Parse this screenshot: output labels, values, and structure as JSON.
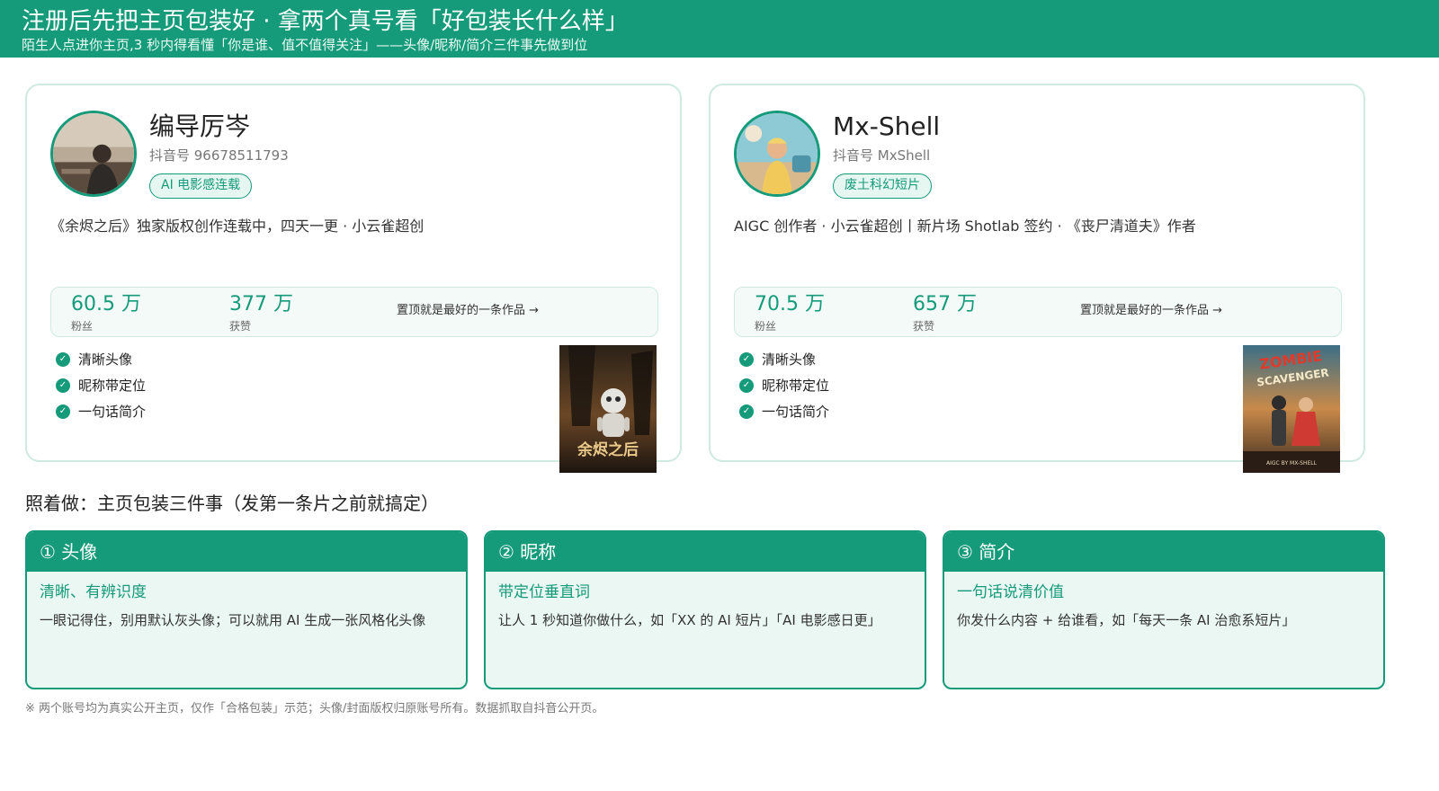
{
  "banner": {
    "title": "注册后先把主页包装好 ·  拿两个真号看「好包装长什么样」",
    "subtitle": "陌生人点进你主页,3 秒内得看懂「你是谁、值不值得关注」——头像/昵称/简介三件事先做到位"
  },
  "profiles": [
    {
      "name": "编导厉岑",
      "account": "抖音号 96678511793",
      "tag": "AI 电影感连载",
      "bio": "《余烬之后》独家版权创作连载中，四天一更 ·  小云雀超创",
      "followers_value": "60.5 万",
      "followers_label": "粉丝",
      "likes_value": "377 万",
      "likes_label": "获赞",
      "pinned": "置顶就是最好的一条作品 →",
      "checks": [
        "清晰头像",
        "昵称带定位",
        "一句话简介"
      ],
      "poster_title": "余烬之后"
    },
    {
      "name": "Mx-Shell",
      "account": "抖音号 MxShell",
      "tag": "废土科幻短片",
      "bio": "AIGC 创作者 ·  小云雀超创丨新片场 Shotlab 签约 ·  《丧尸清道夫》作者",
      "followers_value": "70.5 万",
      "followers_label": "粉丝",
      "likes_value": "657 万",
      "likes_label": "获赞",
      "pinned": "置顶就是最好的一条作品 →",
      "checks": [
        "清晰头像",
        "昵称带定位",
        "一句话简介"
      ],
      "poster_title": "ZOMBIE SCAVENGER"
    }
  ],
  "section_title": "照着做：主页包装三件事（发第一条片之前就搞定）",
  "steps": [
    {
      "head": "① 头像",
      "sub": "清晰、有辨识度",
      "body": "一眼记得住，别用默认灰头像；可以就用 AI 生成一张风格化头像"
    },
    {
      "head": "② 昵称",
      "sub": "带定位垂直词",
      "body": "让人 1 秒知道你做什么，如「XX 的 AI 短片」「AI 电影感日更」"
    },
    {
      "head": "③ 简介",
      "sub": "一句话说清价值",
      "body": "你发什么内容 + 给谁看，如「每天一条 AI 治愈系短片」"
    }
  ],
  "footnote": "※ 两个账号均为真实公开主页，仅作「合格包装」示范；头像/封面版权归原账号所有。数据抓取自抖音公开页。",
  "colors": {
    "accent": "#159a7a",
    "card_border": "#cfeadf",
    "step_bg": "#eaf7f2"
  },
  "icons": {
    "check": "check-circle-icon",
    "arrow": "arrow-right-icon"
  }
}
